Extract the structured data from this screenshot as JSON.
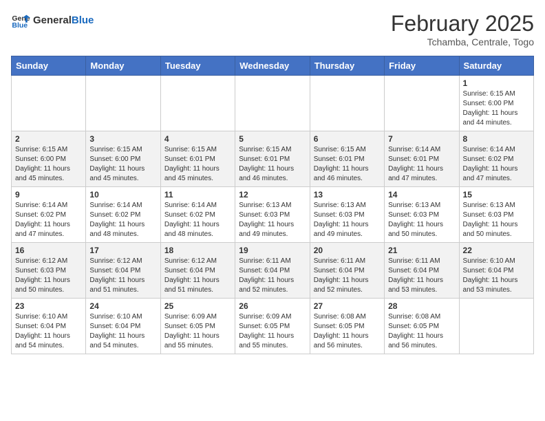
{
  "header": {
    "logo_general": "General",
    "logo_blue": "Blue",
    "month_title": "February 2025",
    "location": "Tchamba, Centrale, Togo"
  },
  "weekdays": [
    "Sunday",
    "Monday",
    "Tuesday",
    "Wednesday",
    "Thursday",
    "Friday",
    "Saturday"
  ],
  "weeks": [
    [
      {
        "day": "",
        "sunrise": "",
        "sunset": "",
        "daylight": ""
      },
      {
        "day": "",
        "sunrise": "",
        "sunset": "",
        "daylight": ""
      },
      {
        "day": "",
        "sunrise": "",
        "sunset": "",
        "daylight": ""
      },
      {
        "day": "",
        "sunrise": "",
        "sunset": "",
        "daylight": ""
      },
      {
        "day": "",
        "sunrise": "",
        "sunset": "",
        "daylight": ""
      },
      {
        "day": "",
        "sunrise": "",
        "sunset": "",
        "daylight": ""
      },
      {
        "day": "1",
        "sunrise": "Sunrise: 6:15 AM",
        "sunset": "Sunset: 6:00 PM",
        "daylight": "Daylight: 11 hours and 44 minutes."
      }
    ],
    [
      {
        "day": "2",
        "sunrise": "Sunrise: 6:15 AM",
        "sunset": "Sunset: 6:00 PM",
        "daylight": "Daylight: 11 hours and 45 minutes."
      },
      {
        "day": "3",
        "sunrise": "Sunrise: 6:15 AM",
        "sunset": "Sunset: 6:00 PM",
        "daylight": "Daylight: 11 hours and 45 minutes."
      },
      {
        "day": "4",
        "sunrise": "Sunrise: 6:15 AM",
        "sunset": "Sunset: 6:01 PM",
        "daylight": "Daylight: 11 hours and 45 minutes."
      },
      {
        "day": "5",
        "sunrise": "Sunrise: 6:15 AM",
        "sunset": "Sunset: 6:01 PM",
        "daylight": "Daylight: 11 hours and 46 minutes."
      },
      {
        "day": "6",
        "sunrise": "Sunrise: 6:15 AM",
        "sunset": "Sunset: 6:01 PM",
        "daylight": "Daylight: 11 hours and 46 minutes."
      },
      {
        "day": "7",
        "sunrise": "Sunrise: 6:14 AM",
        "sunset": "Sunset: 6:01 PM",
        "daylight": "Daylight: 11 hours and 47 minutes."
      },
      {
        "day": "8",
        "sunrise": "Sunrise: 6:14 AM",
        "sunset": "Sunset: 6:02 PM",
        "daylight": "Daylight: 11 hours and 47 minutes."
      }
    ],
    [
      {
        "day": "9",
        "sunrise": "Sunrise: 6:14 AM",
        "sunset": "Sunset: 6:02 PM",
        "daylight": "Daylight: 11 hours and 47 minutes."
      },
      {
        "day": "10",
        "sunrise": "Sunrise: 6:14 AM",
        "sunset": "Sunset: 6:02 PM",
        "daylight": "Daylight: 11 hours and 48 minutes."
      },
      {
        "day": "11",
        "sunrise": "Sunrise: 6:14 AM",
        "sunset": "Sunset: 6:02 PM",
        "daylight": "Daylight: 11 hours and 48 minutes."
      },
      {
        "day": "12",
        "sunrise": "Sunrise: 6:13 AM",
        "sunset": "Sunset: 6:03 PM",
        "daylight": "Daylight: 11 hours and 49 minutes."
      },
      {
        "day": "13",
        "sunrise": "Sunrise: 6:13 AM",
        "sunset": "Sunset: 6:03 PM",
        "daylight": "Daylight: 11 hours and 49 minutes."
      },
      {
        "day": "14",
        "sunrise": "Sunrise: 6:13 AM",
        "sunset": "Sunset: 6:03 PM",
        "daylight": "Daylight: 11 hours and 50 minutes."
      },
      {
        "day": "15",
        "sunrise": "Sunrise: 6:13 AM",
        "sunset": "Sunset: 6:03 PM",
        "daylight": "Daylight: 11 hours and 50 minutes."
      }
    ],
    [
      {
        "day": "16",
        "sunrise": "Sunrise: 6:12 AM",
        "sunset": "Sunset: 6:03 PM",
        "daylight": "Daylight: 11 hours and 50 minutes."
      },
      {
        "day": "17",
        "sunrise": "Sunrise: 6:12 AM",
        "sunset": "Sunset: 6:04 PM",
        "daylight": "Daylight: 11 hours and 51 minutes."
      },
      {
        "day": "18",
        "sunrise": "Sunrise: 6:12 AM",
        "sunset": "Sunset: 6:04 PM",
        "daylight": "Daylight: 11 hours and 51 minutes."
      },
      {
        "day": "19",
        "sunrise": "Sunrise: 6:11 AM",
        "sunset": "Sunset: 6:04 PM",
        "daylight": "Daylight: 11 hours and 52 minutes."
      },
      {
        "day": "20",
        "sunrise": "Sunrise: 6:11 AM",
        "sunset": "Sunset: 6:04 PM",
        "daylight": "Daylight: 11 hours and 52 minutes."
      },
      {
        "day": "21",
        "sunrise": "Sunrise: 6:11 AM",
        "sunset": "Sunset: 6:04 PM",
        "daylight": "Daylight: 11 hours and 53 minutes."
      },
      {
        "day": "22",
        "sunrise": "Sunrise: 6:10 AM",
        "sunset": "Sunset: 6:04 PM",
        "daylight": "Daylight: 11 hours and 53 minutes."
      }
    ],
    [
      {
        "day": "23",
        "sunrise": "Sunrise: 6:10 AM",
        "sunset": "Sunset: 6:04 PM",
        "daylight": "Daylight: 11 hours and 54 minutes."
      },
      {
        "day": "24",
        "sunrise": "Sunrise: 6:10 AM",
        "sunset": "Sunset: 6:04 PM",
        "daylight": "Daylight: 11 hours and 54 minutes."
      },
      {
        "day": "25",
        "sunrise": "Sunrise: 6:09 AM",
        "sunset": "Sunset: 6:05 PM",
        "daylight": "Daylight: 11 hours and 55 minutes."
      },
      {
        "day": "26",
        "sunrise": "Sunrise: 6:09 AM",
        "sunset": "Sunset: 6:05 PM",
        "daylight": "Daylight: 11 hours and 55 minutes."
      },
      {
        "day": "27",
        "sunrise": "Sunrise: 6:08 AM",
        "sunset": "Sunset: 6:05 PM",
        "daylight": "Daylight: 11 hours and 56 minutes."
      },
      {
        "day": "28",
        "sunrise": "Sunrise: 6:08 AM",
        "sunset": "Sunset: 6:05 PM",
        "daylight": "Daylight: 11 hours and 56 minutes."
      },
      {
        "day": "",
        "sunrise": "",
        "sunset": "",
        "daylight": ""
      }
    ]
  ]
}
